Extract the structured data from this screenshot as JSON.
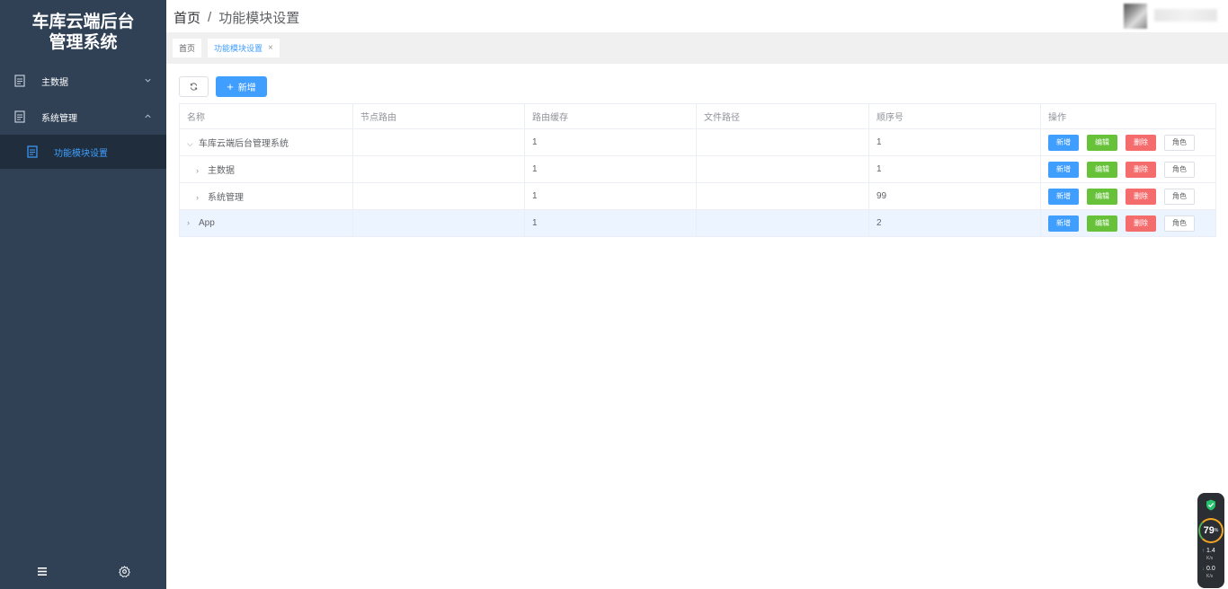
{
  "app": {
    "title_line1": "车库云端后台",
    "title_line2": "管理系统"
  },
  "sidebar": {
    "items": [
      {
        "label": "主数据",
        "icon": "document-icon",
        "expanded": false
      },
      {
        "label": "系统管理",
        "icon": "document-icon",
        "expanded": true,
        "children": [
          {
            "label": "功能模块设置",
            "icon": "document-icon",
            "active": true
          }
        ]
      }
    ],
    "bottom": {
      "menu_icon": "menu-icon",
      "settings_icon": "gear-icon"
    }
  },
  "header": {
    "breadcrumb": [
      "首页",
      "功能模块设置"
    ],
    "separator": "/"
  },
  "tabs": [
    {
      "label": "首页",
      "active": false,
      "closable": false
    },
    {
      "label": "功能模块设置",
      "active": true,
      "closable": true,
      "close_glyph": "×"
    }
  ],
  "toolbar": {
    "refresh_icon": "refresh-icon",
    "add_label": "新增",
    "add_glyph": "+"
  },
  "table": {
    "columns": [
      "名称",
      "节点路由",
      "路由缓存",
      "文件路径",
      "顺序号",
      "操作"
    ],
    "rows": [
      {
        "name": "车库云端后台管理系统",
        "route": "",
        "cache": "1",
        "path": "",
        "order": "1",
        "level": 0,
        "arrow": "down"
      },
      {
        "name": "主数据",
        "route": "",
        "cache": "1",
        "path": "",
        "order": "1",
        "level": 1,
        "arrow": "right"
      },
      {
        "name": "系统管理",
        "route": "",
        "cache": "1",
        "path": "",
        "order": "99",
        "level": 1,
        "arrow": "right"
      },
      {
        "name": "App",
        "route": "",
        "cache": "1",
        "path": "",
        "order": "2",
        "level": 0,
        "arrow": "right",
        "highlighted": true
      }
    ],
    "actions": {
      "add": "新增",
      "edit": "编辑",
      "delete": "删除",
      "role": "角色"
    }
  },
  "widget": {
    "score": "79",
    "score_unit": "%",
    "upload": {
      "value": "1.4",
      "unit": "K/s",
      "arrow": "↑"
    },
    "download": {
      "value": "0.0",
      "unit": "K/s",
      "arrow": "↓"
    }
  },
  "colors": {
    "sidebar_bg": "#304156",
    "accent": "#409eff",
    "success": "#67c23a",
    "danger": "#f56c6c",
    "highlight_row": "#ecf5ff"
  }
}
